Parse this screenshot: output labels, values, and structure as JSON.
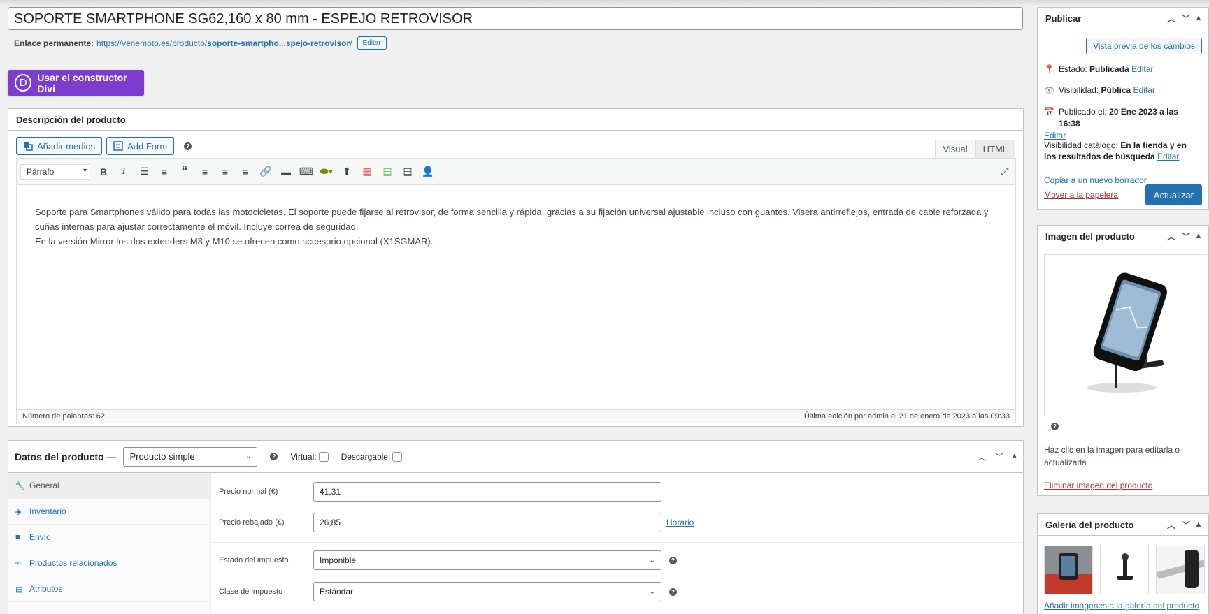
{
  "post": {
    "title": "SOPORTE SMARTPHONE SG62,160 x 80 mm - ESPEJO RETROVISOR",
    "permalink_label": "Enlace permanente:",
    "permalink_pre": "https://venemoto.es/producto/",
    "permalink_slug": "soporte-smartpho...spejo-retrovisor",
    "permalink_post": "/",
    "edit_label": "Editar"
  },
  "divi": {
    "label": "Usar el constructor Divi",
    "icon_letter": "D"
  },
  "description": {
    "title": "Descripción del producto",
    "add_media": "Añadir medios",
    "add_form": "Add Form",
    "tab_visual": "Visual",
    "tab_html": "HTML",
    "format": "Párrafo",
    "paragraph1": "Soporte para Smartphones válido para todas las motocicletas. El soporte puede fijarse al retrovisor, de forma sencilla y rápida, gracias a su fijación universal ajustable incluso con guantes. Visera antirreflejos, entrada de cable reforzada y cuñas internas para ajustar correctamente el móvil. Incluye correa de seguridad.",
    "paragraph2": "En la versión Mirror los dos extenders M8 y M10 se ofrecen como accesorio opcional (X1SGMAR).",
    "word_count": "Número de palabras: 62",
    "last_edit": "Última edición por admin el 21 de enero de 2023 a las 09:33"
  },
  "product_data": {
    "title": "Datos del producto —",
    "type": "Producto simple",
    "virtual_label": "Virtual:",
    "downloadable_label": "Descargable:",
    "tabs": [
      {
        "label": "General",
        "icon": "wrench-icon"
      },
      {
        "label": "Inventario",
        "icon": "tag-icon"
      },
      {
        "label": "Envío",
        "icon": "truck-icon"
      },
      {
        "label": "Productos relacionados",
        "icon": "link-icon"
      },
      {
        "label": "Atributos",
        "icon": "list-icon"
      }
    ],
    "regular_price_label": "Precio normal (€)",
    "regular_price": "41,31",
    "sale_price_label": "Precio rebajado (€)",
    "sale_price": "26,85",
    "schedule_label": "Horario",
    "tax_status_label": "Estado del impuesto",
    "tax_status": "Imponible",
    "tax_class_label": "Clase de impuesto",
    "tax_class": "Estándar"
  },
  "publish": {
    "title": "Publicar",
    "preview_label": "Vista previa de los cambios",
    "status_label": "Estado:",
    "status_value": "Publicada",
    "visibility_label": "Visibilidad:",
    "visibility_value": "Pública",
    "published_label": "Publicado el:",
    "published_value": "20 Ene 2023 a las 16:38",
    "catalog_label": "Visibilidad catálogo:",
    "catalog_value": "En la tienda y en los resultados de búsqueda",
    "edit_label": "Editar",
    "copy_draft": "Copiar a un nuevo borrador",
    "trash": "Mover a la papelera",
    "update": "Actualizar"
  },
  "product_image": {
    "title": "Imagen del producto",
    "hint": "Haz clic en la imagen para editarla o actualizarla",
    "remove": "Eliminar imagen del producto"
  },
  "gallery": {
    "title": "Galería del producto",
    "add": "Añadir imágenes a la galería del producto"
  },
  "colors": {
    "accent": "#2271b1",
    "divi": "#7e3bd0",
    "danger": "#b32d2e"
  }
}
